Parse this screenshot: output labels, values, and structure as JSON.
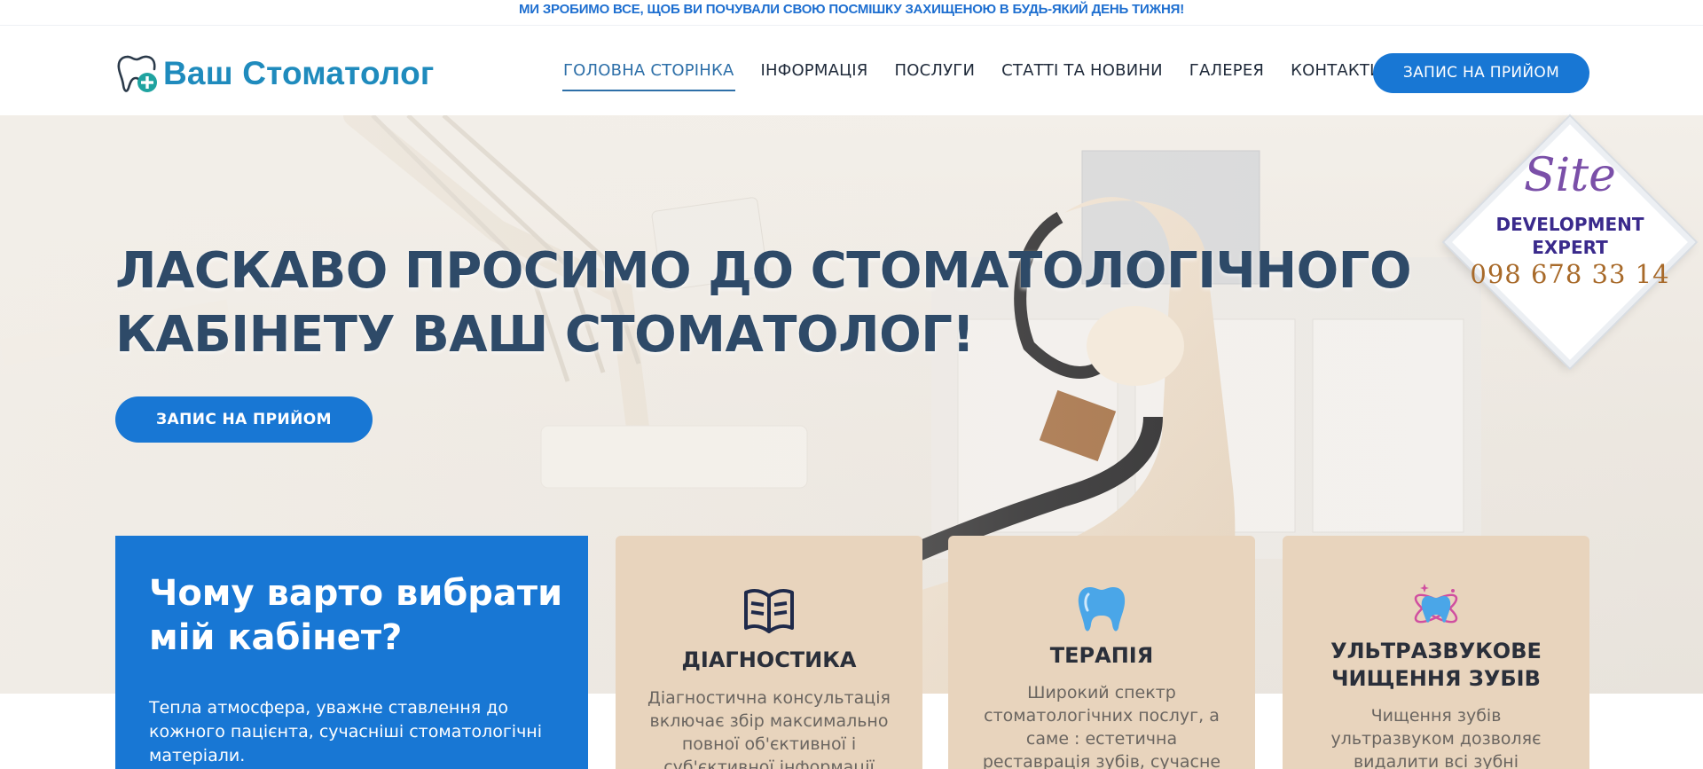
{
  "top_banner": {
    "text": "МИ ЗРОБИМО ВСЕ, ЩОБ ВИ ПОЧУВАЛИ СВОЮ ПОСМІШКУ ЗАХИЩЕНОЮ В БУДЬ-ЯКИЙ ДЕНЬ ТИЖНЯ!"
  },
  "header": {
    "logo_text": "Ваш Стоматолог",
    "logo_icon": "tooth-plus-icon",
    "nav": [
      {
        "label": "ГОЛОВНА СТОРІНКА",
        "active": true
      },
      {
        "label": "ІНФОРМАЦІЯ"
      },
      {
        "label": "ПОСЛУГИ"
      },
      {
        "label": "СТАТТІ ТА НОВИНИ"
      },
      {
        "label": "ГАЛЕРЕЯ"
      },
      {
        "label": "КОНТАКТИ"
      }
    ],
    "cta_label": "ЗАПИС НА ПРИЙОМ"
  },
  "hero": {
    "title_line1": "ЛАСКАВО ПРОСИМО ДО СТОМАТОЛОГІЧНОГО",
    "title_line2": "КАБІНЕТУ ВАШ СТОМАТОЛОГ!",
    "cta_label": "ЗАПИС НА ПРИЙОМ"
  },
  "badge": {
    "site": "Site",
    "line1": "DEVELOPMENT",
    "line2": "EXPERT",
    "phone": "098 678 33 14"
  },
  "why": {
    "title": "Чому варто вибрати мій кабінет?",
    "text": "Тепла атмосфера, уважне ставлення до кожного пацієнта, сучасніші стоматологічні матеріали."
  },
  "services": [
    {
      "icon": "book-icon",
      "title": "ДІАГНОСТИКА",
      "text": "Діагностична консультація включає збір максимально повної об'єктивної і суб'єктивної інформації"
    },
    {
      "icon": "tooth-icon",
      "title": "ТЕРАПІЯ",
      "text": "Широкий спектр стоматологічних послуг, а саме : естетична реставрація зубів, сучасне"
    },
    {
      "icon": "sparkle-tooth-icon",
      "title": "УЛЬТРАЗВУКОВЕ ЧИЩЕННЯ ЗУБІВ",
      "text": "Чищення зубів ультразвуком дозволяє видалити всі зубні"
    }
  ],
  "colors": {
    "accent": "#1877d4",
    "logo": "#1f8bbd",
    "card": "#e8d4bd",
    "title": "#2e4a68"
  }
}
